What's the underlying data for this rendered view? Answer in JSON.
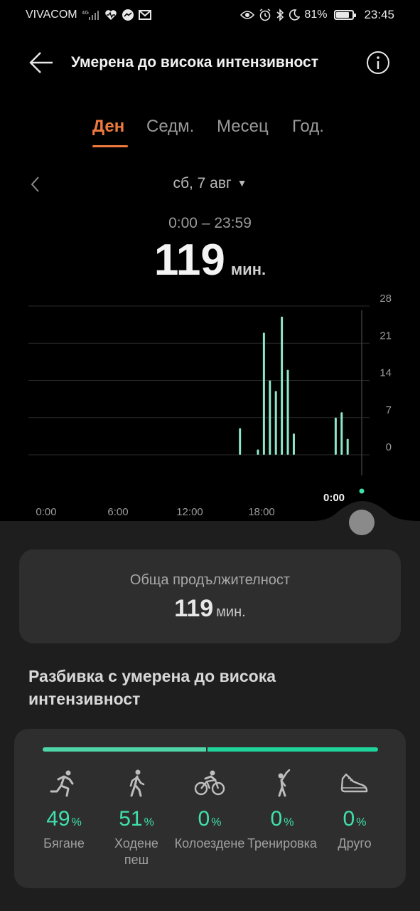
{
  "status_bar": {
    "carrier": "VIVACOM",
    "battery_percent": "81%",
    "battery_level": 0.81,
    "time": "23:45"
  },
  "header": {
    "title": "Умерена до висока интензивност"
  },
  "tabs": [
    {
      "label": "Ден",
      "active": true
    },
    {
      "label": "Седм.",
      "active": false
    },
    {
      "label": "Месец",
      "active": false
    },
    {
      "label": "Год.",
      "active": false
    }
  ],
  "date": {
    "label": "сб, 7 авг"
  },
  "summary": {
    "range": "0:00 – 23:59",
    "value": "119",
    "unit": "мин."
  },
  "chart_data": {
    "type": "bar",
    "x_unit": "hour",
    "xlim": [
      0,
      24
    ],
    "ylim": [
      0,
      28
    ],
    "y_ticks": [
      "28",
      "21",
      "14",
      "7",
      "0"
    ],
    "y_tick_values": [
      28,
      21,
      14,
      7,
      0
    ],
    "x_tick_labels": [
      "0:00",
      "6:00",
      "12:00",
      "18:00"
    ],
    "x_tick_values": [
      0,
      6,
      12,
      18
    ],
    "cursor_label": "0:00",
    "color": "#8ee8c8",
    "bars": [
      {
        "x": 16.2,
        "value": 5
      },
      {
        "x": 17.7,
        "value": 1
      },
      {
        "x": 18.2,
        "value": 23
      },
      {
        "x": 18.7,
        "value": 14
      },
      {
        "x": 19.2,
        "value": 12
      },
      {
        "x": 19.7,
        "value": 26
      },
      {
        "x": 20.2,
        "value": 16
      },
      {
        "x": 20.7,
        "value": 4
      },
      {
        "x": 24.2,
        "value": 7
      },
      {
        "x": 24.7,
        "value": 8
      },
      {
        "x": 25.2,
        "value": 3
      }
    ]
  },
  "total": {
    "label": "Обща продължителност",
    "value": "119",
    "unit": "мин."
  },
  "breakdown": {
    "title": "Разбивка с умерена до висока интензивност",
    "bar": {
      "seg1_fraction": 0.49,
      "seg2_fraction": 0.51,
      "seg1_color": "#4fd6a8",
      "seg2_color": "#1fd49a"
    },
    "activities": [
      {
        "icon": "running-icon",
        "value": "49",
        "pct": "%",
        "label": "Бягане"
      },
      {
        "icon": "walking-icon",
        "value": "51",
        "pct": "%",
        "label": "Ходене пеш"
      },
      {
        "icon": "cycling-icon",
        "value": "0",
        "pct": "%",
        "label": "Колоездене"
      },
      {
        "icon": "workout-icon",
        "value": "0",
        "pct": "%",
        "label": "Тренировка"
      },
      {
        "icon": "shoe-icon",
        "value": "0",
        "pct": "%",
        "label": "Друго"
      }
    ]
  }
}
